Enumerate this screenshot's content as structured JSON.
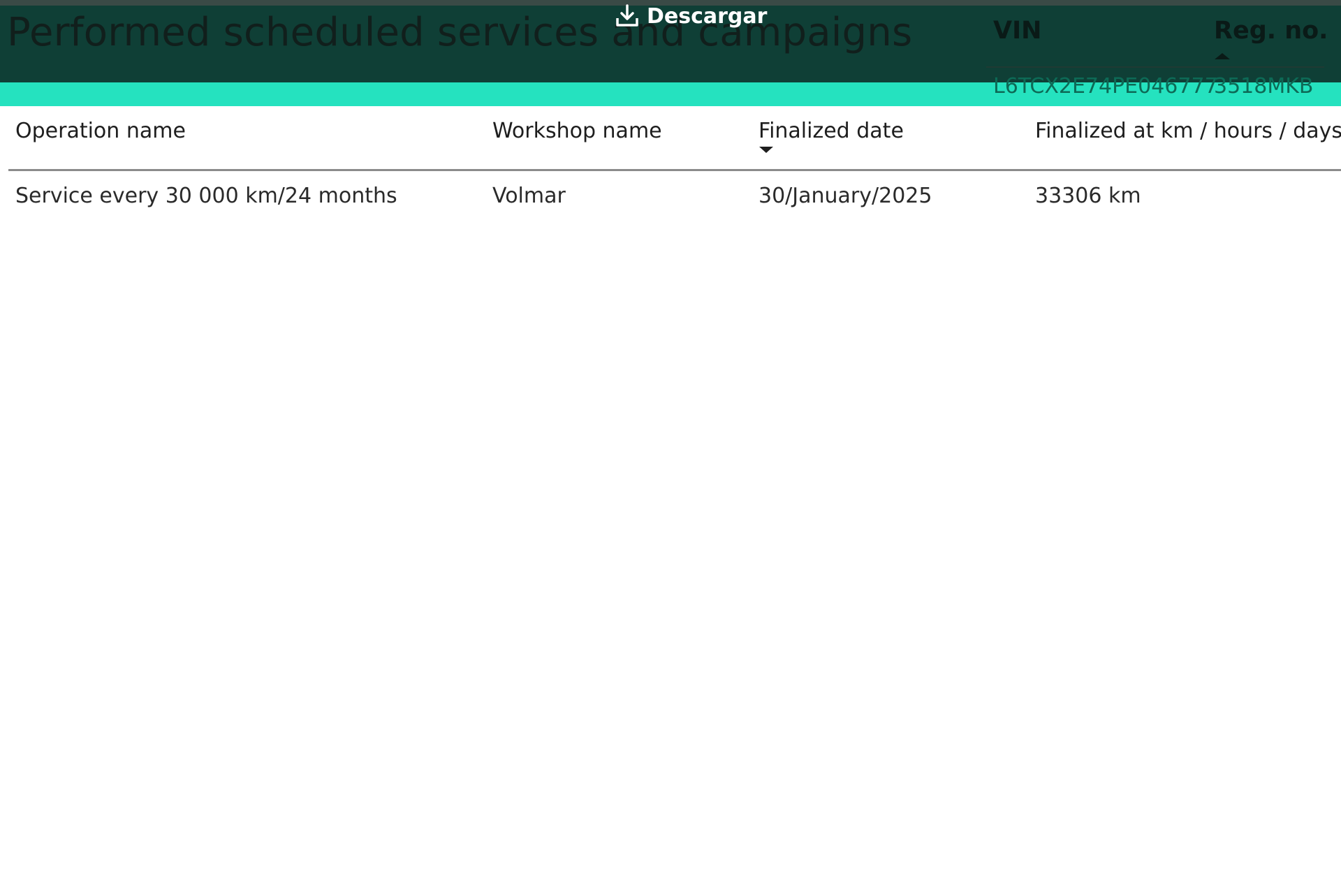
{
  "header": {
    "title": "Performed scheduled services and campaigns",
    "download_label": "Descargar",
    "download_icon": "download-icon",
    "colors": {
      "header_bg": "#0f3f36",
      "accent": "#25e2bf",
      "vin_value_text": "#0d6a56"
    }
  },
  "vehicle": {
    "columns": [
      "VIN",
      "Reg. no."
    ],
    "sort": {
      "column": "Reg. no.",
      "direction": "ascending"
    },
    "values": {
      "vin": "L6TCX2E74PE046777",
      "reg": "3518MKB"
    }
  },
  "table": {
    "columns": [
      "Operation name",
      "Workshop name",
      "Finalized date",
      "Finalized at km / hours / days"
    ],
    "sort": {
      "column": "Finalized date",
      "direction": "descending"
    },
    "rows": [
      {
        "operation": "Service every 30 000 km/24 months",
        "workshop": "Volmar",
        "date": "30/January/2025",
        "finalized_at": "33306 km"
      }
    ]
  }
}
